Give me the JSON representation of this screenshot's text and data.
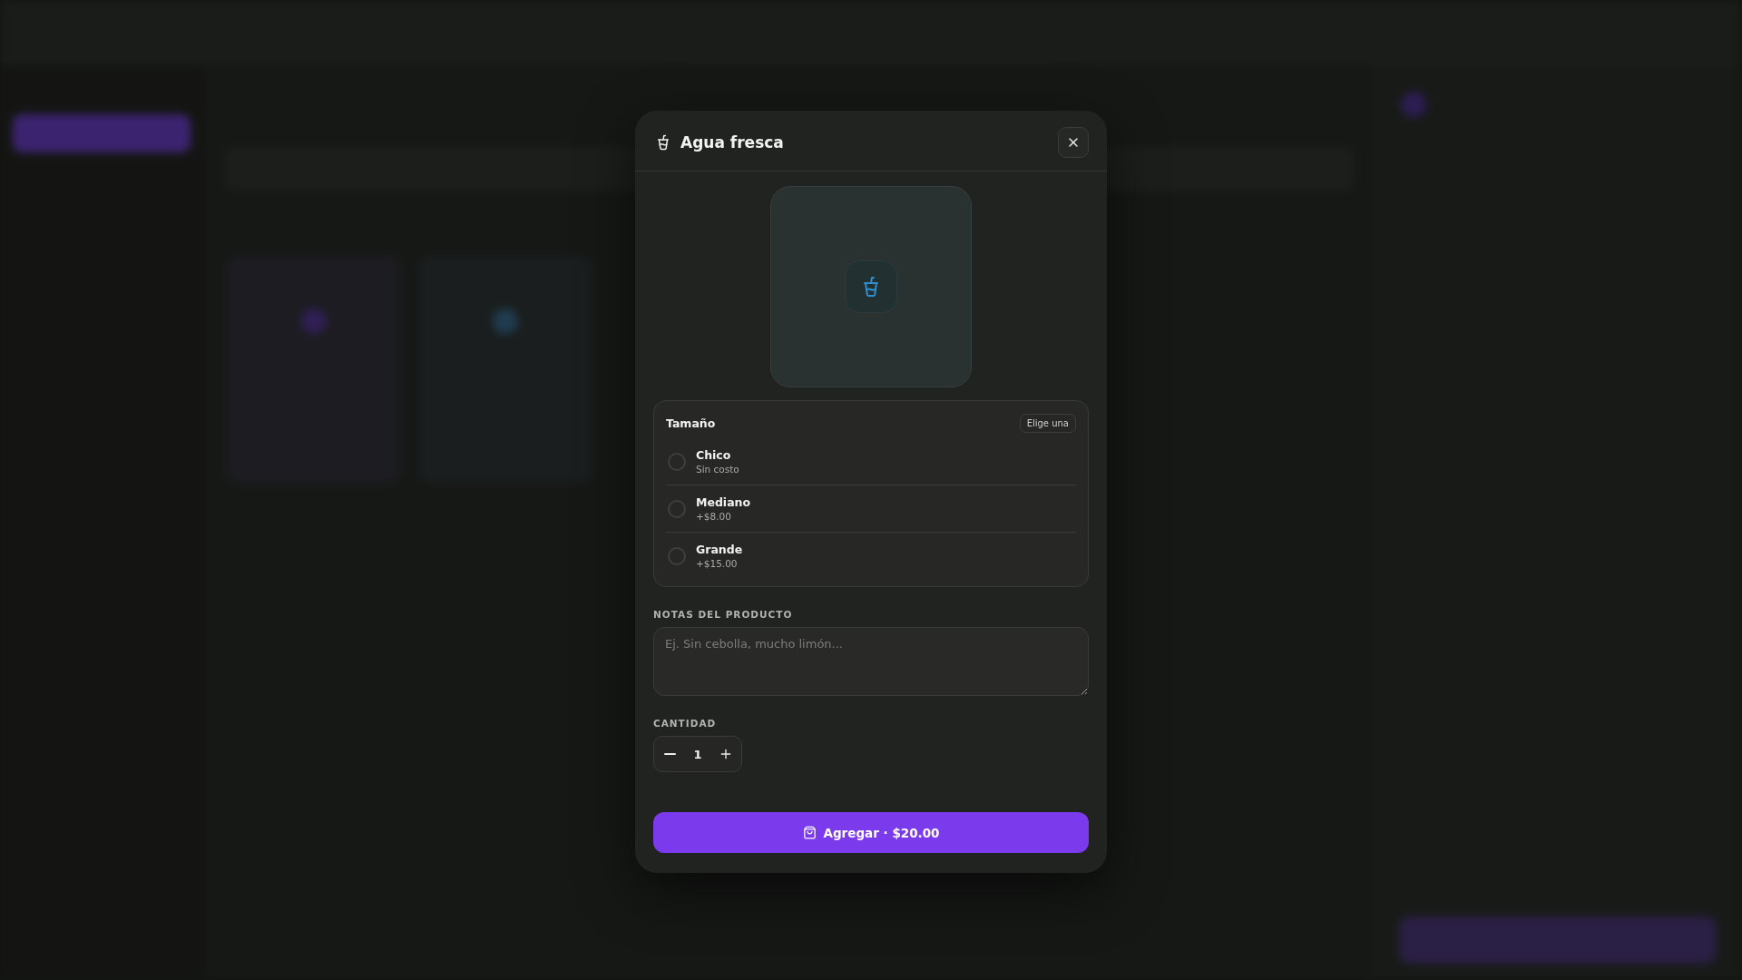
{
  "dialog": {
    "title": "Agua fresca"
  },
  "option_group": {
    "title": "Tamaño",
    "badge": "Elige una",
    "options": [
      {
        "name": "Chico",
        "price": "Sin costo",
        "selected": false
      },
      {
        "name": "Mediano",
        "price": "+$8.00",
        "selected": false
      },
      {
        "name": "Grande",
        "price": "+$15.00",
        "selected": false
      }
    ]
  },
  "notes": {
    "label": "NOTAS DEL PRODUCTO",
    "placeholder": "Ej. Sin cebolla, mucho limón..."
  },
  "quantity": {
    "label": "CANTIDAD",
    "value": "1"
  },
  "add_button": {
    "label": "Agregar · $20.00"
  }
}
